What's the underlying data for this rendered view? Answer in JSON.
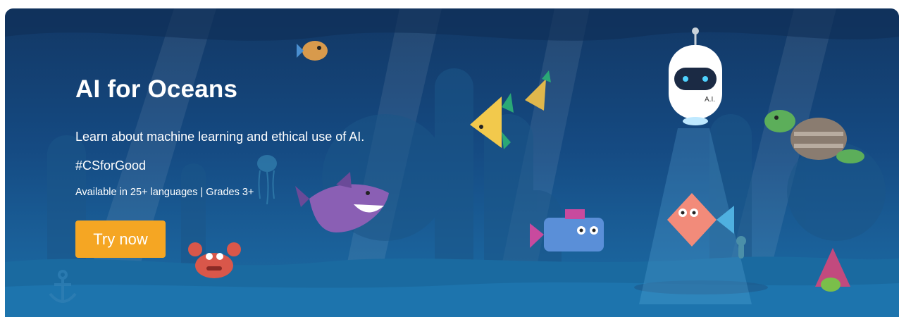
{
  "banner": {
    "title": "AI for Oceans",
    "description": "Learn about machine learning and ethical use of AI.",
    "hashtag": "#CSforGood",
    "availability": "Available in 25+ languages | Grades 3+",
    "cta_label": "Try now",
    "robot_label": "A.I."
  },
  "colors": {
    "ocean_dark": "#123764",
    "ocean_light": "#1c6ea6",
    "cta": "#f5a623",
    "text": "#ffffff"
  }
}
